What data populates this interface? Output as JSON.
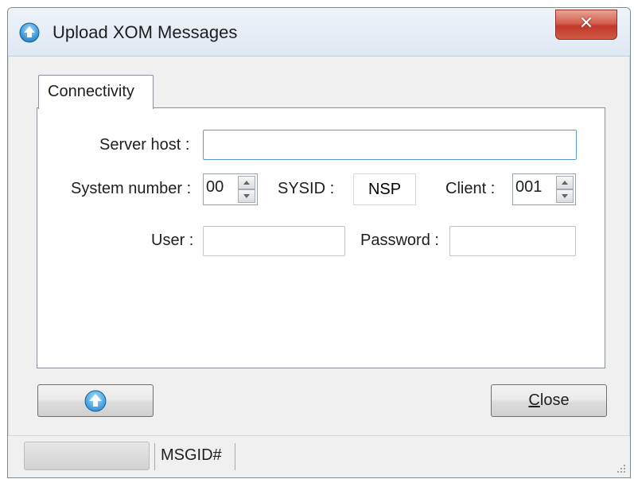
{
  "window": {
    "title": "Upload XOM Messages",
    "close_glyph": "✕"
  },
  "tabs": [
    {
      "label": "Connectivity",
      "selected": true
    }
  ],
  "connectivity": {
    "server_host": {
      "label": "Server host :",
      "value": ""
    },
    "system_number": {
      "label": "System number :",
      "value": "00"
    },
    "sysid": {
      "label": "SYSID :",
      "value": "NSP"
    },
    "client": {
      "label": "Client :",
      "value": "001"
    },
    "user": {
      "label": "User :",
      "value": ""
    },
    "password": {
      "label": "Password :",
      "value": ""
    }
  },
  "buttons": {
    "upload_icon": "upload-icon",
    "close_label": "Close",
    "close_mnemonic": "C",
    "close_rest": "lose"
  },
  "status": {
    "message": "MSGID#"
  },
  "colors": {
    "close_button_red": "#c1392b",
    "focus_border": "#5b9bd5",
    "upload_icon_blue": "#2e8fd6"
  }
}
